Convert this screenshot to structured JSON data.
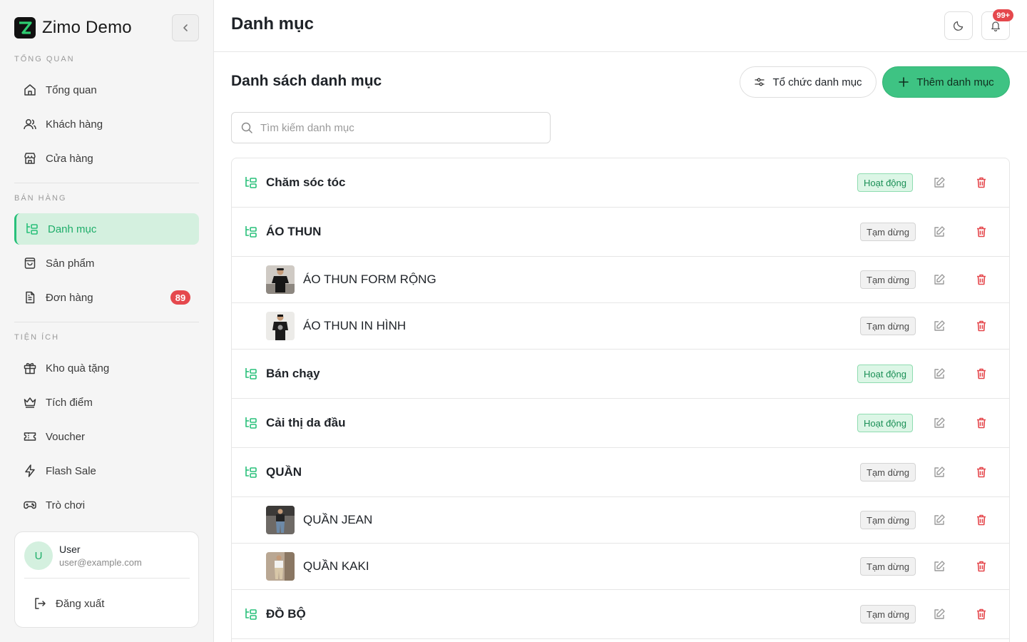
{
  "app": {
    "name": "Zimo Demo"
  },
  "sidebar": {
    "sections": [
      {
        "label": "TỔNG QUAN",
        "items": [
          {
            "label": "Tổng quan",
            "icon": "home-icon"
          },
          {
            "label": "Khách hàng",
            "icon": "users-icon"
          },
          {
            "label": "Cửa hàng",
            "icon": "store-icon"
          }
        ]
      },
      {
        "label": "BÁN HÀNG",
        "items": [
          {
            "label": "Danh mục",
            "icon": "category-tree-icon",
            "active": true
          },
          {
            "label": "Sản phẩm",
            "icon": "shopping-bag-icon"
          },
          {
            "label": "Đơn hàng",
            "icon": "file-text-icon",
            "badge": "89"
          }
        ]
      },
      {
        "label": "TIỆN ÍCH",
        "items": [
          {
            "label": "Kho quà tặng",
            "icon": "gift-icon"
          },
          {
            "label": "Tích điểm",
            "icon": "crown-icon"
          },
          {
            "label": "Voucher",
            "icon": "ticket-icon"
          },
          {
            "label": "Flash Sale",
            "icon": "lightning-icon"
          },
          {
            "label": "Trò chơi",
            "icon": "gamepad-icon"
          }
        ]
      }
    ],
    "user": {
      "initial": "U",
      "name": "User",
      "email": "user@example.com",
      "logout_label": "Đăng xuất"
    }
  },
  "header": {
    "title": "Danh mục",
    "notification_count": "99+"
  },
  "main": {
    "section_title": "Danh sách danh mục",
    "organize_label": "Tổ chức danh mục",
    "add_label": "Thêm danh mục",
    "search_placeholder": "Tìm kiếm danh mục",
    "categories": [
      {
        "name": "Chăm sóc tóc",
        "level": "parent",
        "status": "Hoạt động",
        "status_type": "active"
      },
      {
        "name": "ÁO THUN",
        "level": "parent",
        "status": "Tạm dừng",
        "status_type": "paused"
      },
      {
        "name": "ÁO THUN FORM RỘNG",
        "level": "child",
        "status": "Tạm dừng",
        "status_type": "paused"
      },
      {
        "name": "ÁO THUN IN HÌNH",
        "level": "child",
        "status": "Tạm dừng",
        "status_type": "paused"
      },
      {
        "name": "Bán chạy",
        "level": "parent",
        "status": "Hoạt động",
        "status_type": "active"
      },
      {
        "name": "Cải thị da đầu",
        "level": "parent",
        "status": "Hoạt động",
        "status_type": "active"
      },
      {
        "name": "QUẦN",
        "level": "parent",
        "status": "Tạm dừng",
        "status_type": "paused"
      },
      {
        "name": "QUẦN JEAN",
        "level": "child",
        "status": "Tạm dừng",
        "status_type": "paused"
      },
      {
        "name": "QUẦN KAKI",
        "level": "child",
        "status": "Tạm dừng",
        "status_type": "paused"
      },
      {
        "name": "ĐỒ BỘ",
        "level": "parent",
        "status": "Tạm dừng",
        "status_type": "paused"
      }
    ]
  },
  "colors": {
    "accent": "#29c07a",
    "danger": "#e5484d",
    "active_bg": "#d4f0df"
  }
}
